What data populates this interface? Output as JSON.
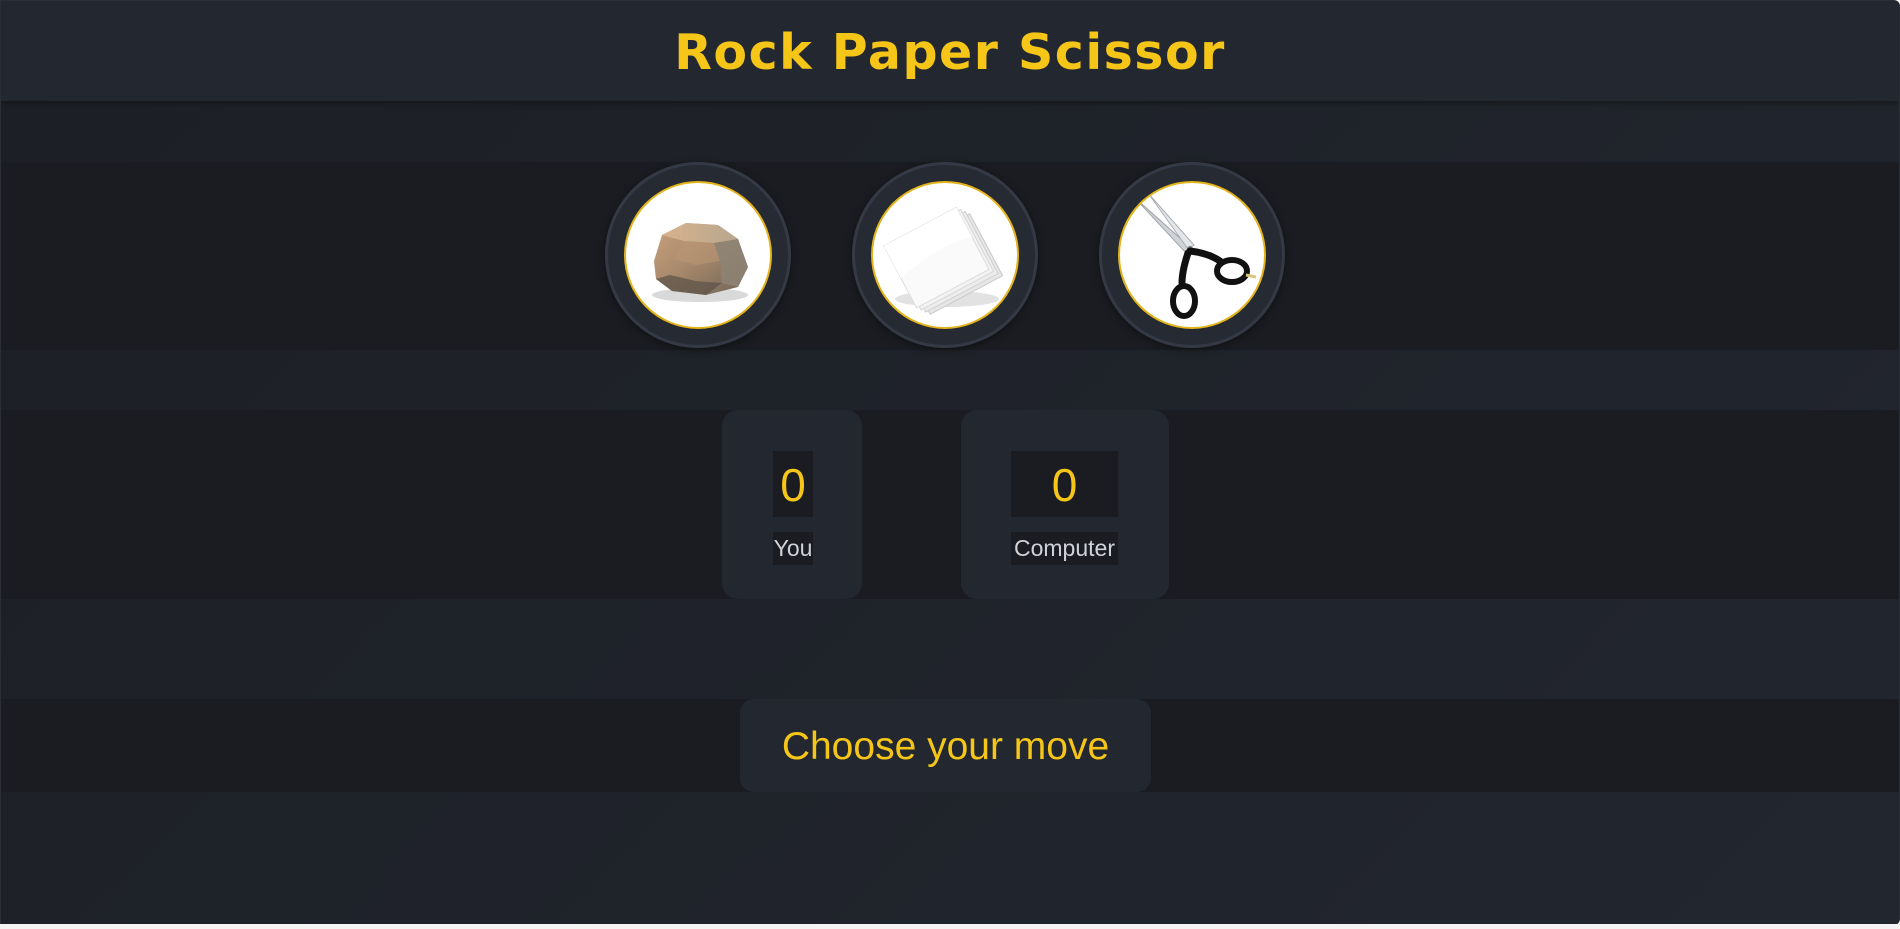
{
  "header": {
    "title": "Rock Paper Scissor"
  },
  "choices": [
    {
      "name": "rock",
      "icon": "rock-icon"
    },
    {
      "name": "paper",
      "icon": "paper-icon"
    },
    {
      "name": "scissors",
      "icon": "scissors-icon"
    }
  ],
  "scoreboard": {
    "user": {
      "score": "0",
      "label": "You"
    },
    "computer": {
      "score": "0",
      "label": "Computer"
    }
  },
  "message": {
    "text": "Choose your move"
  },
  "colors": {
    "accent": "#f5c518",
    "background": "#1e2128",
    "panel": "#232730",
    "band": "#1a1c21"
  }
}
